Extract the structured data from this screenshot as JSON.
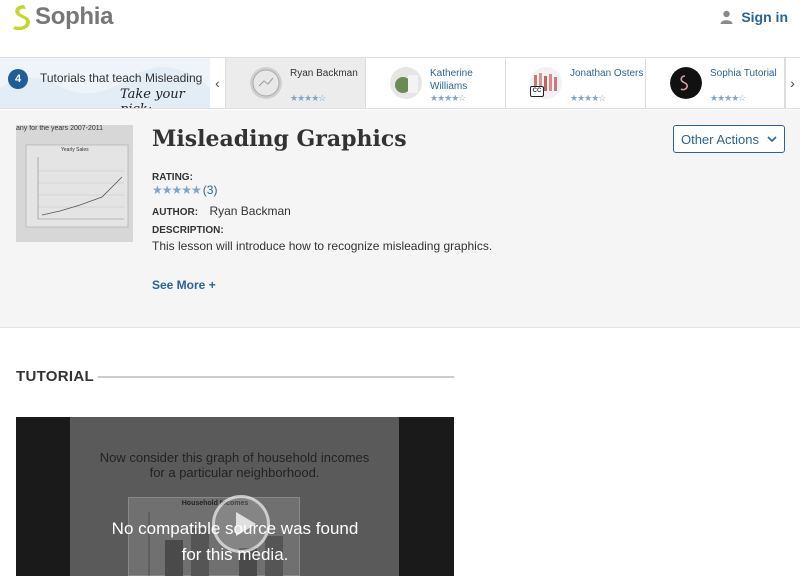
{
  "header": {
    "brand": "Sophia",
    "sign_in": "Sign in",
    "accent": "#c5d630"
  },
  "strip": {
    "count": "4",
    "title": "Tutorials that teach Misleading Graphics",
    "pick": "Take your pick:",
    "cards": [
      {
        "name": "Ryan Backman",
        "stars": "★★★★☆",
        "active": true
      },
      {
        "name": "Katherine Williams",
        "stars": "★★★★☆"
      },
      {
        "name": "Jonathan Osters",
        "stars": "★★★★☆",
        "badge": "CC"
      },
      {
        "name": "Sophia Tutorial",
        "stars": "★★★★☆"
      }
    ]
  },
  "lesson": {
    "title": "Misleading Graphics",
    "other_actions": "Other Actions",
    "rating_label": "RATING:",
    "rating_stars": "★★★★★",
    "rating_count": "(3)",
    "author_label": "AUTHOR:",
    "author": "Ryan Backman",
    "description_label": "DESCRIPTION:",
    "description": "This lesson will introduce how to recognize misleading graphics.",
    "see_more": "See More +",
    "thumb": {
      "caption": "any for the years 2007-2011",
      "chart_title": "Yearly Sales"
    }
  },
  "tutorial": {
    "heading": "TUTORIAL",
    "slide_text_1": "Now consider this graph of household incomes",
    "slide_text_2": "for a particular neighborhood.",
    "chart_title": "Household Incomes",
    "message_1": "No compatible source was found",
    "message_2": "for this media."
  }
}
